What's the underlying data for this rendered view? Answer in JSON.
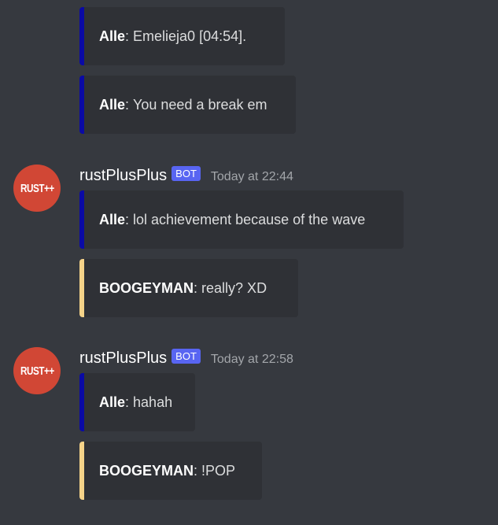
{
  "messages": [
    {
      "username": "rustPlusPlus",
      "avatar_text": "RUST++",
      "bot_tag": "BOT",
      "timestamp": "Today at 22:44"
    },
    {
      "username": "rustPlusPlus",
      "avatar_text": "RUST++",
      "bot_tag": "BOT",
      "timestamp": "Today at 22:58"
    }
  ],
  "embeds": [
    {
      "author": "Alle",
      "separator": ": ",
      "text": "Emelieja0 [04:54].",
      "color": "#0a0aa5"
    },
    {
      "author": "Alle",
      "separator": ": ",
      "text": "You need a break em",
      "color": "#0a0aa5"
    },
    {
      "author": "Alle",
      "separator": ": ",
      "text": "lol achievement because of the wave",
      "color": "#0a0aa5"
    },
    {
      "author": "BOOGEYMAN",
      "separator": ": ",
      "text": "really? XD",
      "color": "#f5d389"
    },
    {
      "author": "Alle",
      "separator": ": ",
      "text": "hahah",
      "color": "#0a0aa5"
    },
    {
      "author": "BOOGEYMAN",
      "separator": ": ",
      "text": "!POP",
      "color": "#f5d389"
    }
  ],
  "theme": {
    "background": "#36393f",
    "embed_background": "#2f3136",
    "bot_tag_color": "#5865f2",
    "avatar_color": "#d14735"
  }
}
